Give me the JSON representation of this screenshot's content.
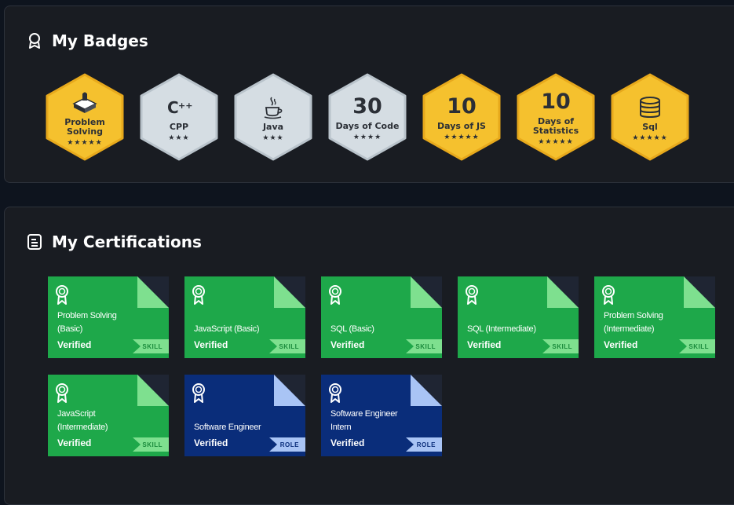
{
  "badges_section": {
    "title": "My Badges",
    "icon": "badge-ribbon-icon",
    "items": [
      {
        "label": "Problem Solving",
        "number": "",
        "icon": "problem-solving-icon",
        "stars": "★★★★★",
        "tier": "gold"
      },
      {
        "label": "CPP",
        "number": "",
        "icon": "cpp-icon",
        "stars": "★★★",
        "tier": "silver"
      },
      {
        "label": "Java",
        "number": "",
        "icon": "java-icon",
        "stars": "★★★",
        "tier": "silver"
      },
      {
        "label": "Days of Code",
        "number": "30",
        "icon": "",
        "stars": "★★★★",
        "tier": "silver"
      },
      {
        "label": "Days of JS",
        "number": "10",
        "icon": "",
        "stars": "★★★★★",
        "tier": "gold"
      },
      {
        "label": "Days of Statistics",
        "number": "10",
        "icon": "",
        "stars": "★★★★★",
        "tier": "gold"
      },
      {
        "label": "Sql",
        "number": "",
        "icon": "database-icon",
        "stars": "★★★★★",
        "tier": "gold"
      }
    ]
  },
  "certifications_section": {
    "title": "My Certifications",
    "icon": "certificate-document-icon",
    "items": [
      {
        "title": "Problem Solving (Basic)",
        "status": "Verified",
        "tag": "SKILL",
        "kind": "skill"
      },
      {
        "title": "JavaScript (Basic)",
        "status": "Verified",
        "tag": "SKILL",
        "kind": "skill"
      },
      {
        "title": "SQL (Basic)",
        "status": "Verified",
        "tag": "SKILL",
        "kind": "skill"
      },
      {
        "title": "SQL (Intermediate)",
        "status": "Verified",
        "tag": "SKILL",
        "kind": "skill"
      },
      {
        "title": "Problem Solving (Intermediate)",
        "status": "Verified",
        "tag": "SKILL",
        "kind": "skill"
      },
      {
        "title": "JavaScript (Intermediate)",
        "status": "Verified",
        "tag": "SKILL",
        "kind": "skill"
      },
      {
        "title": "Software Engineer",
        "status": "Verified",
        "tag": "ROLE",
        "kind": "role"
      },
      {
        "title": "Software Engineer Intern",
        "status": "Verified",
        "tag": "ROLE",
        "kind": "role"
      }
    ]
  },
  "colors": {
    "page_bg": "#0e141e",
    "panel_bg": "#191c22",
    "gold_badge": "#f5c12e",
    "silver_badge": "#d5dde3",
    "skill_cert": "#1ea84a",
    "role_cert": "#0a2d7a"
  }
}
